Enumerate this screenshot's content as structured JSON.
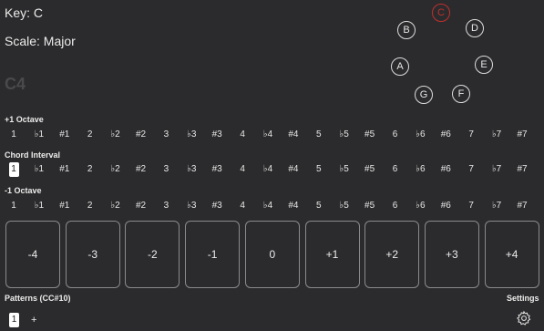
{
  "header": {
    "key": "Key: C",
    "scale": "Scale: Major",
    "current_note": "C4"
  },
  "circle_of_notes": [
    {
      "label": "C",
      "active": true
    },
    {
      "label": "D",
      "active": false
    },
    {
      "label": "E",
      "active": false
    },
    {
      "label": "F",
      "active": false
    },
    {
      "label": "G",
      "active": false
    },
    {
      "label": "A",
      "active": false
    },
    {
      "label": "B",
      "active": false
    }
  ],
  "rows": {
    "octave_up": {
      "title": "+1 Octave",
      "intervals": [
        "1",
        "♭1",
        "#1",
        "2",
        "♭2",
        "#2",
        "3",
        "♭3",
        "#3",
        "4",
        "♭4",
        "#4",
        "5",
        "♭5",
        "#5",
        "6",
        "♭6",
        "#6",
        "7",
        "♭7",
        "#7"
      ]
    },
    "chord_interval": {
      "title": "Chord Interval",
      "selected": "1",
      "intervals": [
        "1",
        "♭1",
        "#1",
        "2",
        "♭2",
        "#2",
        "3",
        "♭3",
        "#3",
        "4",
        "♭4",
        "#4",
        "5",
        "♭5",
        "#5",
        "6",
        "♭6",
        "#6",
        "7",
        "♭7",
        "#7"
      ]
    },
    "octave_down": {
      "title": "-1 Octave",
      "intervals": [
        "1",
        "♭1",
        "#1",
        "2",
        "♭2",
        "#2",
        "3",
        "♭3",
        "#3",
        "4",
        "♭4",
        "#4",
        "5",
        "♭5",
        "#5",
        "6",
        "♭6",
        "#6",
        "7",
        "♭7",
        "#7"
      ]
    }
  },
  "offset_buttons": [
    "-4",
    "-3",
    "-2",
    "-1",
    "0",
    "+1",
    "+2",
    "+3",
    "+4"
  ],
  "footer": {
    "patterns_title": "Patterns (CC#10)",
    "selected_pattern": "1",
    "add_label": "+",
    "settings_title": "Settings",
    "settings_icon": "gear-icon"
  },
  "colors": {
    "background": "#2b2b2d",
    "active_note": "#c0302e",
    "text": "#ececec"
  }
}
